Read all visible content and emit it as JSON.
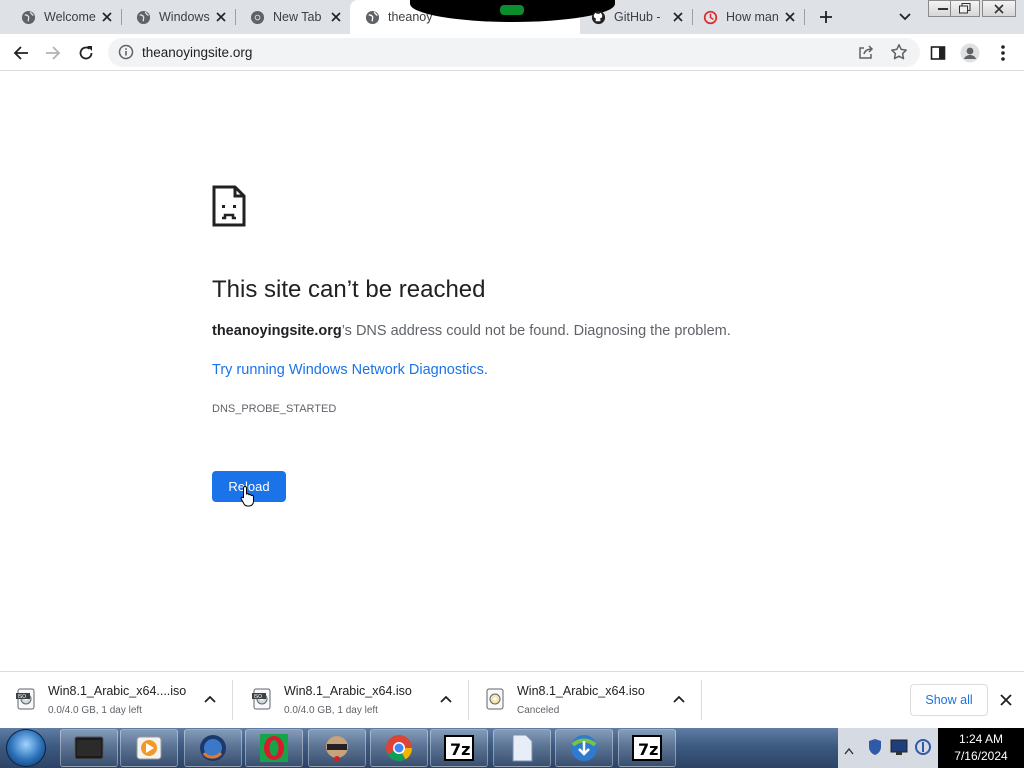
{
  "tabs": [
    {
      "title": "Welcome",
      "icon": "globe-icon"
    },
    {
      "title": "Windows",
      "icon": "globe-icon"
    },
    {
      "title": "New Tab",
      "icon": "chrome-icon"
    },
    {
      "title": "theanoy",
      "icon": "globe-icon",
      "active": true
    },
    {
      "title": "GitHub -",
      "icon": "github-icon"
    },
    {
      "title": "How man",
      "icon": "clock-icon"
    }
  ],
  "toolbar": {
    "url": "theanoyingsite.org"
  },
  "error": {
    "headline": "This site can’t be reached",
    "host": "theanoyingsite.org",
    "message_rest": "’s DNS address could not be found. Diagnosing the problem.",
    "suggestion": "Try running Windows Network Diagnostics",
    "suggestion_end": ".",
    "code": "DNS_PROBE_STARTED",
    "reload_label": "Reload"
  },
  "downloads": [
    {
      "name": "Win8.1_Arabic_x64....iso",
      "status": "0.0/4.0 GB, 1 day left"
    },
    {
      "name": "Win8.1_Arabic_x64.iso",
      "status": "0.0/4.0 GB, 1 day left"
    },
    {
      "name": "Win8.1_Arabic_x64.iso",
      "status": "Canceled"
    }
  ],
  "shelf": {
    "show_all": "Show all"
  },
  "taskbar": {
    "apps": [
      "terminal-icon",
      "media-player-icon",
      "firefox-icon",
      "opera-icon",
      "agent-icon",
      "chrome-icon",
      "7zip-icon",
      "file-icon",
      "download-manager-icon",
      "7zip-icon"
    ],
    "time": "1:24 AM",
    "date": "7/16/2024"
  },
  "colors": {
    "accent": "#1a73e8",
    "text": "#202124",
    "secondary": "#5f6368",
    "tabstrip": "#dee1e6"
  }
}
